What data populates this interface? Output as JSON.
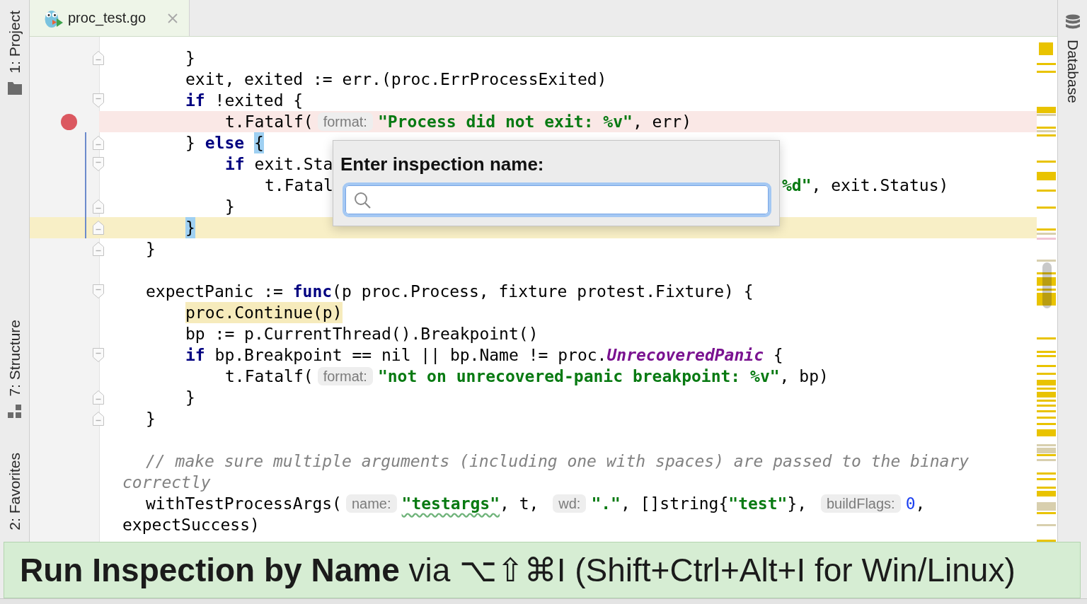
{
  "tabs": [
    {
      "label": "proc_test.go",
      "selected": true
    }
  ],
  "left_tool_buttons": [
    {
      "label": "1: Project",
      "kind": "project",
      "selected": false
    },
    {
      "label": "7: Structure",
      "kind": "structure",
      "selected": false
    },
    {
      "label": "2: Favorites",
      "kind": "favorites",
      "selected": false
    }
  ],
  "right_tool_buttons": [
    {
      "label": "Database",
      "kind": "database",
      "selected": false
    }
  ],
  "editor": {
    "lines": [
      {
        "kind": "block",
        "children": [
          {
            "kind": "code",
            "tokens": [
              {
                "kind": "plain",
                "text": "}"
              }
            ],
            "breakpoint": false,
            "caret": false,
            "changed": false,
            "fold_start": false,
            "fold_end": true
          },
          {
            "kind": "code",
            "tokens": [
              {
                "kind": "plain",
                "text": "exit, exited := err.(proc.ErrProcessExited)"
              }
            ],
            "breakpoint": false,
            "caret": false,
            "changed": false,
            "fold_start": false,
            "fold_end": false
          },
          {
            "kind": "code",
            "tokens": [
              {
                "kind": "keyword",
                "text": "if"
              },
              {
                "kind": "plain",
                "text": " !exited {"
              }
            ],
            "breakpoint": false,
            "caret": false,
            "changed": false,
            "fold_start": true,
            "fold_end": false,
            "children": [
              {
                "kind": "code",
                "tokens": [
                  {
                    "kind": "plain",
                    "text": "t.Fatalf("
                  },
                  {
                    "kind": "hint",
                    "text": "format:"
                  },
                  {
                    "kind": "string",
                    "text": "\"Process did not exit: %v\""
                  },
                  {
                    "kind": "plain",
                    "text": ", err)"
                  }
                ],
                "breakpoint": true,
                "caret": false,
                "changed": false,
                "fold_start": false,
                "fold_end": false
              }
            ]
          },
          {
            "kind": "code",
            "tokens": [
              {
                "kind": "plain",
                "text": "} "
              },
              {
                "kind": "keyword",
                "text": "else "
              },
              {
                "kind": "brace",
                "text": "{"
              }
            ],
            "breakpoint": false,
            "caret": false,
            "changed": true,
            "fold_start": false,
            "fold_end": true,
            "children": [
              {
                "kind": "code",
                "tokens": [
                  {
                    "kind": "keyword",
                    "text": "if"
                  },
                  {
                    "kind": "plain",
                    "text": " exit.Sta"
                  }
                ],
                "breakpoint": false,
                "caret": false,
                "changed": true,
                "fold_start": true,
                "fold_end": false,
                "children": [
                  {
                    "kind": "code",
                    "tokens": [
                      {
                        "kind": "plain",
                        "text": "t.Fatal"
                      }
                    ],
                    "after_popup": [
                      {
                        "kind": "string",
                        "text": "%d\""
                      },
                      {
                        "kind": "plain",
                        "text": ", exit.Status)"
                      }
                    ],
                    "breakpoint": false,
                    "caret": false,
                    "changed": true,
                    "fold_start": false,
                    "fold_end": false
                  }
                ]
              },
              {
                "kind": "code",
                "tokens": [
                  {
                    "kind": "plain",
                    "text": "}"
                  }
                ],
                "breakpoint": false,
                "caret": false,
                "changed": true,
                "fold_start": false,
                "fold_end": true
              }
            ]
          },
          {
            "kind": "code",
            "tokens": [
              {
                "kind": "brace",
                "text": "}"
              }
            ],
            "breakpoint": false,
            "caret": true,
            "changed": true,
            "fold_start": false,
            "fold_end": true
          }
        ]
      },
      {
        "kind": "code",
        "tokens": [
          {
            "kind": "plain",
            "text": "}"
          }
        ],
        "breakpoint": false,
        "caret": false,
        "changed": false,
        "fold_start": false,
        "fold_end": true
      },
      {
        "kind": "blank"
      },
      {
        "kind": "code",
        "tokens": [
          {
            "kind": "plain",
            "text": "expectPanic := "
          },
          {
            "kind": "keyword",
            "text": "func"
          },
          {
            "kind": "plain",
            "text": "(p proc.Process, fixture protest.Fixture) {"
          }
        ],
        "breakpoint": false,
        "caret": false,
        "changed": false,
        "fold_start": true,
        "fold_end": false,
        "children": [
          {
            "kind": "code",
            "tokens": [
              {
                "kind": "usage",
                "text": "proc.Continue(p)"
              }
            ],
            "breakpoint": false,
            "caret": false,
            "changed": false,
            "fold_start": false,
            "fold_end": false
          },
          {
            "kind": "code",
            "tokens": [
              {
                "kind": "plain",
                "text": "bp := p.CurrentThread().Breakpoint()"
              }
            ],
            "breakpoint": false,
            "caret": false,
            "changed": false,
            "fold_start": false,
            "fold_end": false
          },
          {
            "kind": "code",
            "tokens": [
              {
                "kind": "keyword",
                "text": "if"
              },
              {
                "kind": "plain",
                "text": " bp.Breakpoint == nil || bp.Name != proc."
              },
              {
                "kind": "type",
                "text": "UnrecoveredPanic"
              },
              {
                "kind": "plain",
                "text": " {"
              }
            ],
            "breakpoint": false,
            "caret": false,
            "changed": false,
            "fold_start": true,
            "fold_end": false,
            "children": [
              {
                "kind": "code",
                "tokens": [
                  {
                    "kind": "plain",
                    "text": "t.Fatalf("
                  },
                  {
                    "kind": "hint",
                    "text": "format:"
                  },
                  {
                    "kind": "string",
                    "text": "\"not on unrecovered-panic breakpoint: %v\""
                  },
                  {
                    "kind": "plain",
                    "text": ", bp)"
                  }
                ],
                "breakpoint": false,
                "caret": false,
                "changed": false,
                "fold_start": false,
                "fold_end": false
              }
            ]
          },
          {
            "kind": "code",
            "tokens": [
              {
                "kind": "plain",
                "text": "}"
              }
            ],
            "breakpoint": false,
            "caret": false,
            "changed": false,
            "fold_start": false,
            "fold_end": true
          }
        ]
      },
      {
        "kind": "code",
        "tokens": [
          {
            "kind": "plain",
            "text": "}"
          }
        ],
        "breakpoint": false,
        "caret": false,
        "changed": false,
        "fold_start": false,
        "fold_end": true
      },
      {
        "kind": "blank"
      },
      {
        "kind": "code",
        "tokens": [
          {
            "kind": "comment",
            "text": "// make sure multiple arguments (including one with spaces) are passed to the binary"
          }
        ],
        "continuation": [
          {
            "kind": "comment",
            "text": "correctly"
          }
        ],
        "breakpoint": false,
        "caret": false,
        "changed": false,
        "fold_start": false,
        "fold_end": false
      },
      {
        "kind": "code",
        "tokens": [
          {
            "kind": "plain",
            "text": "withTestProcessArgs("
          },
          {
            "kind": "hint",
            "text": "name:"
          },
          {
            "kind": "string_typo",
            "text": "\"testargs\""
          },
          {
            "kind": "plain",
            "text": ", t, "
          },
          {
            "kind": "hint",
            "text": "wd:"
          },
          {
            "kind": "string",
            "text": "\".\""
          },
          {
            "kind": "plain",
            "text": ", []string{"
          },
          {
            "kind": "string",
            "text": "\"test\""
          },
          {
            "kind": "plain",
            "text": "}, "
          },
          {
            "kind": "hint",
            "text": "buildFlags:"
          },
          {
            "kind": "number",
            "text": "0"
          },
          {
            "kind": "plain",
            "text": ","
          }
        ],
        "continuation": [
          {
            "kind": "plain",
            "text": "expectSuccess)"
          }
        ],
        "breakpoint": false,
        "caret": false,
        "changed": false,
        "fold_start": false,
        "fold_end": false
      }
    ]
  },
  "inspection_popup": {
    "title": "Enter inspection name:",
    "search_field": {
      "focused": true
    }
  },
  "tip_banner": {
    "text": "**Run Inspection by Name** via ⌥⇧⌘I (Shift+Ctrl+Alt+I for Win/Linux)"
  }
}
